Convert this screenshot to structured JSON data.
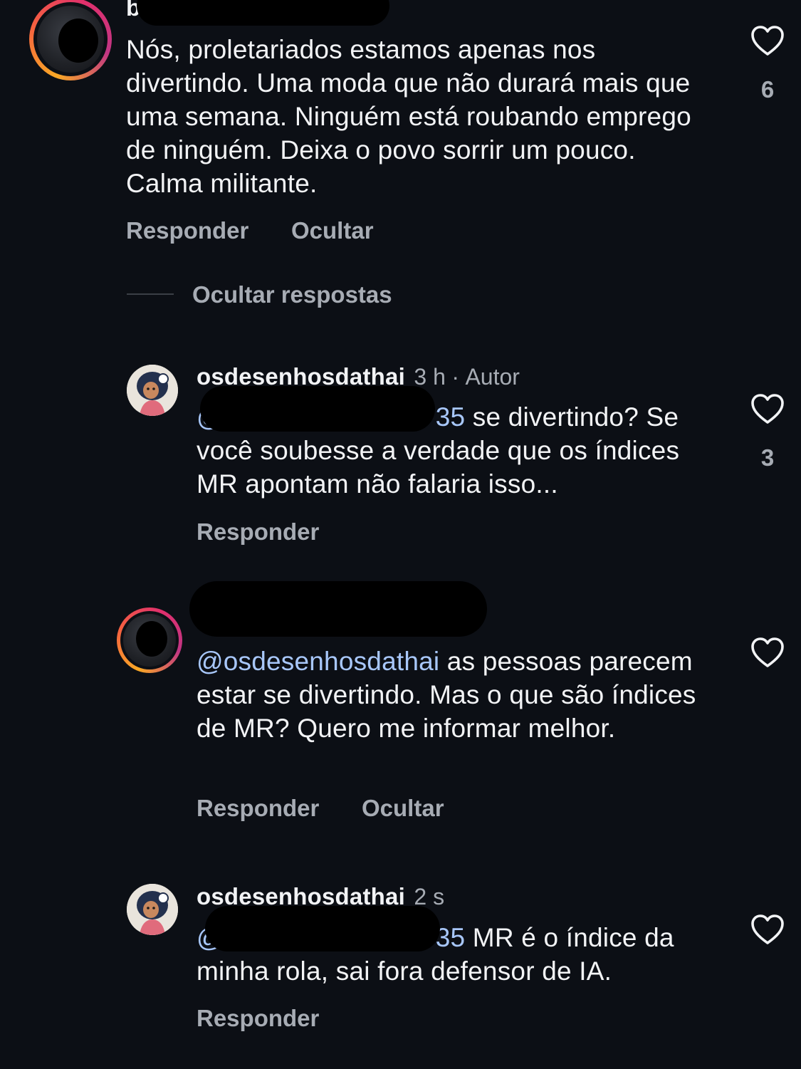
{
  "comments": [
    {
      "username_visible": "b",
      "text": "Nós, proletariados estamos apenas nos divertindo. Uma moda que não durará mais que uma semana. Ninguém está roubando emprego de ninguém. Deixa o povo sorrir um pouco. Calma militante.",
      "likes": "6",
      "actions": [
        "Responder",
        "Ocultar"
      ]
    },
    {
      "username": "osdesenhosdathai",
      "time": "3 h",
      "separator": "·",
      "badge": "Autor",
      "mention_start": "@",
      "mention_end": "35",
      "text": " se divertindo? Se você soubesse a verdade que os índices MR apontam não falaria isso...",
      "likes": "3",
      "actions": [
        "Responder"
      ]
    },
    {
      "username_visible": "",
      "mention": "@osdesenhosdathai",
      "text": " as pessoas parecem estar se divertindo. Mas o que são índices de MR? Quero me informar melhor.",
      "actions": [
        "Responder",
        "Ocultar"
      ]
    },
    {
      "username": "osdesenhosdathai",
      "time": "2 s",
      "mention_start": "@",
      "mention_end": "35",
      "text": " MR é o índice da minha rola, sai fora defensor de IA.",
      "actions": [
        "Responder"
      ]
    }
  ],
  "hide_replies_label": "Ocultar respostas",
  "colors": {
    "background": "#0c0f15",
    "text": "#f2f3f5",
    "muted": "#a7acb4",
    "mention": "#a8c7fa"
  },
  "icons": {
    "like": "heart-outline-icon"
  }
}
